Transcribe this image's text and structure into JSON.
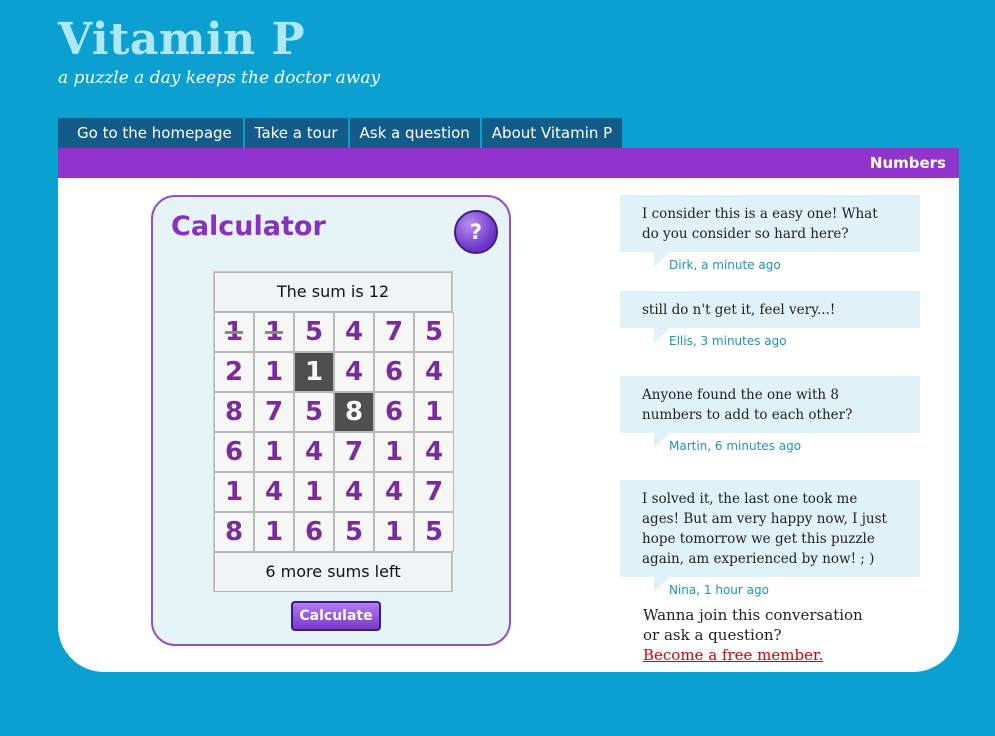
{
  "brand": {
    "title": "Vitamin P",
    "tagline": "a puzzle a day keeps the doctor away"
  },
  "nav": [
    "Go to the homepage",
    "Take a tour",
    "Ask a question",
    "About Vitamin P"
  ],
  "section": {
    "title": "Numbers"
  },
  "calculator": {
    "title": "Calculator",
    "help_label": "?",
    "sum_text": "The sum is 12",
    "grid": [
      [
        1,
        1,
        5,
        4,
        7,
        5
      ],
      [
        2,
        1,
        1,
        4,
        6,
        4
      ],
      [
        8,
        7,
        5,
        8,
        6,
        1
      ],
      [
        6,
        1,
        4,
        7,
        1,
        4
      ],
      [
        1,
        4,
        1,
        4,
        4,
        7
      ],
      [
        8,
        1,
        6,
        5,
        1,
        5
      ]
    ],
    "selected_cells": [
      [
        1,
        2
      ],
      [
        2,
        3
      ]
    ],
    "struck_cells": [
      [
        0,
        0
      ],
      [
        0,
        1
      ]
    ],
    "sums_left_text": "6 more sums left",
    "button_label": "Calculate"
  },
  "comments": [
    {
      "text": "I consider this is a easy one! What do you  consider so hard here?",
      "author": "Dirk, a minute ago"
    },
    {
      "text": "still do n't get it, feel very...!",
      "author": "Ellis, 3 minutes ago"
    },
    {
      "text": "Anyone found the one with 8 numbers to add to each other?",
      "author": "Martin, 6 minutes ago"
    },
    {
      "text": "I solved it, the last one took me ages! But am very happy now, I just hope tomorrow we get this puzzle again, am experienced by now! ; )",
      "author": "Nina, 1 hour ago"
    }
  ],
  "join": {
    "line1": "Wanna join this conversation",
    "line2": "or ask a question?",
    "link": "Become a free member."
  },
  "colors": {
    "background": "#0aa0d0",
    "nav_tab": "#135c8a",
    "section_bar": "#9134cb",
    "accent_purple": "#8a2fc4",
    "selected_cell": "#4f4f4f",
    "link": "#d40000"
  }
}
